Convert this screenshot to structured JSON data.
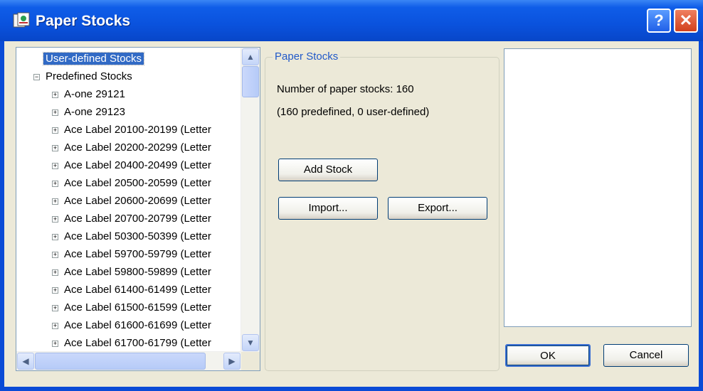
{
  "window": {
    "title": "Paper Stocks",
    "help_label": "?",
    "close_label": "✕"
  },
  "tree": {
    "items": [
      {
        "label": "User-defined Stocks",
        "level": 0,
        "expander": "",
        "selected": true
      },
      {
        "label": "Predefined Stocks",
        "level": 0,
        "expander": "−"
      },
      {
        "label": "A-one 29121",
        "level": 1,
        "expander": "+"
      },
      {
        "label": "A-one 29123",
        "level": 1,
        "expander": "+"
      },
      {
        "label": "Ace Label 20100-20199 (Letter",
        "level": 1,
        "expander": "+"
      },
      {
        "label": "Ace Label 20200-20299 (Letter",
        "level": 1,
        "expander": "+"
      },
      {
        "label": "Ace Label 20400-20499 (Letter",
        "level": 1,
        "expander": "+"
      },
      {
        "label": "Ace Label 20500-20599 (Letter",
        "level": 1,
        "expander": "+"
      },
      {
        "label": "Ace Label 20600-20699 (Letter",
        "level": 1,
        "expander": "+"
      },
      {
        "label": "Ace Label 20700-20799 (Letter",
        "level": 1,
        "expander": "+"
      },
      {
        "label": "Ace Label 50300-50399 (Letter",
        "level": 1,
        "expander": "+"
      },
      {
        "label": "Ace Label 59700-59799 (Letter",
        "level": 1,
        "expander": "+"
      },
      {
        "label": "Ace Label 59800-59899 (Letter",
        "level": 1,
        "expander": "+"
      },
      {
        "label": "Ace Label 61400-61499 (Letter",
        "level": 1,
        "expander": "+"
      },
      {
        "label": "Ace Label 61500-61599 (Letter",
        "level": 1,
        "expander": "+"
      },
      {
        "label": "Ace Label 61600-61699 (Letter",
        "level": 1,
        "expander": "+"
      },
      {
        "label": "Ace Label 61700-61799 (Letter",
        "level": 1,
        "expander": "+"
      }
    ],
    "scroll_up": "▲",
    "scroll_down": "▼",
    "scroll_left": "◀",
    "scroll_right": "▶"
  },
  "group": {
    "legend": "Paper Stocks",
    "count_text": "Number of paper stocks: 160",
    "detail_text": "(160 predefined, 0 user-defined)",
    "add_label": "Add Stock",
    "import_label": "Import...",
    "export_label": "Export..."
  },
  "footer": {
    "ok_label": "OK",
    "cancel_label": "Cancel"
  },
  "colors": {
    "titlebar": "#0a52dd",
    "face": "#ece9d8",
    "selection": "#316ac5",
    "legend": "#2159c9"
  }
}
